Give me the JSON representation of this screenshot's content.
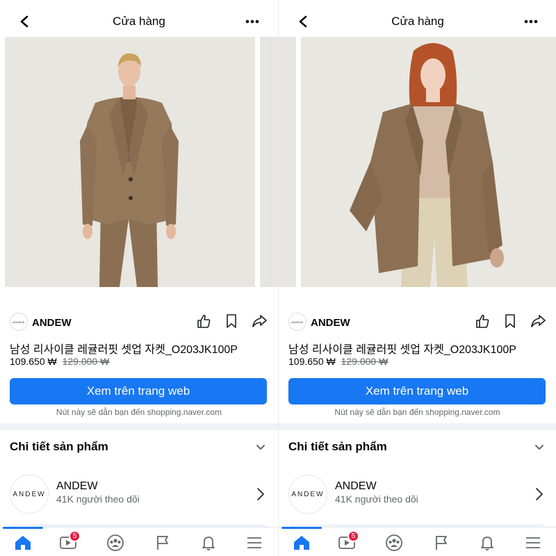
{
  "panels": [
    {
      "header": {
        "title": "Cửa hàng"
      },
      "brand": {
        "name": "ANDEW",
        "avatar_text": "ANDEW"
      },
      "product": {
        "title": "남성 리사이클 레귤러핏 셋업 자켓_O203JK100P",
        "price": "109.650 ₩",
        "old_price": "129.000 ₩"
      },
      "cta": {
        "label": "Xem trên trang web",
        "note": "Nút này sẽ dẫn bạn đến shopping.naver.com"
      },
      "details": {
        "title": "Chi tiết sản phẩm"
      },
      "page": {
        "name": "ANDEW",
        "followers": "41K người theo dõi",
        "avatar_text": "ANDEW"
      },
      "nav": {
        "video_badge": "5"
      }
    },
    {
      "header": {
        "title": "Cửa hàng"
      },
      "brand": {
        "name": "ANDEW",
        "avatar_text": "ANDEW"
      },
      "product": {
        "title": "남성 리사이클 레귤러핏 셋업 자켓_O203JK100P",
        "price": "109.650 ₩",
        "old_price": "129.000 ₩"
      },
      "cta": {
        "label": "Xem trên trang web",
        "note": "Nút này sẽ dẫn bạn đến shopping.naver.com"
      },
      "details": {
        "title": "Chi tiết sản phẩm"
      },
      "page": {
        "name": "ANDEW",
        "followers": "41K người theo dõi",
        "avatar_text": "ANDEW"
      },
      "nav": {
        "video_badge": "5"
      }
    }
  ],
  "colors": {
    "accent": "#1877f2",
    "badge": "#e41e3f",
    "secondary_text": "#65676b",
    "separator": "#f0f2f5"
  },
  "icons": {
    "header": [
      "back-arrow-icon",
      "more-dots-icon"
    ],
    "actions": [
      "thumbs-up-icon",
      "bookmark-icon",
      "share-icon"
    ],
    "nav": [
      "home-icon",
      "video-icon",
      "groups-icon",
      "flag-icon",
      "bell-icon",
      "menu-icon"
    ]
  }
}
